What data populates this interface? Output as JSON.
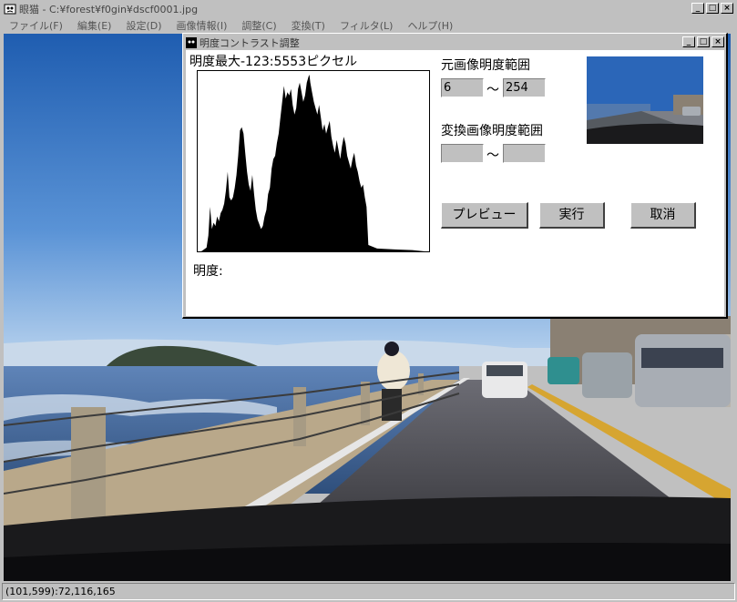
{
  "window": {
    "title": "眼猫 - C:¥forest¥f0gin¥dscf0001.jpg",
    "status": "(101,599):72,116,165"
  },
  "menu": [
    "ファイル(F)",
    "編集(E)",
    "設定(D)",
    "画像情報(I)",
    "調整(C)",
    "変換(T)",
    "フィルタ(L)",
    "ヘルプ(H)"
  ],
  "dialog": {
    "title": "明度コントラスト調整",
    "max_label": "明度最大-123:5553ピクセル",
    "brightness_label": "明度:",
    "source_range_label": "元画像明度範囲",
    "source_min": "6",
    "source_max": "254",
    "target_range_label": "変換画像明度範囲",
    "target_min": "",
    "target_max": "",
    "tilde": "～",
    "buttons": {
      "preview": "プレビュー",
      "execute": "実行",
      "cancel": "取消"
    }
  },
  "chart_data": {
    "type": "area",
    "title": "",
    "xlabel": "",
    "ylabel": "",
    "xlim": [
      0,
      255
    ],
    "ylim": [
      0,
      5553
    ],
    "peak": {
      "x": 123,
      "y": 5553
    },
    "x": [
      0,
      6,
      8,
      10,
      12,
      14,
      16,
      18,
      20,
      22,
      24,
      26,
      28,
      30,
      32,
      34,
      36,
      38,
      40,
      42,
      44,
      46,
      48,
      50,
      52,
      54,
      56,
      58,
      60,
      62,
      64,
      66,
      68,
      70,
      72,
      74,
      76,
      78,
      80,
      82,
      84,
      86,
      88,
      90,
      92,
      94,
      96,
      98,
      100,
      102,
      104,
      106,
      108,
      110,
      112,
      114,
      116,
      118,
      120,
      122,
      123,
      124,
      126,
      128,
      130,
      132,
      134,
      136,
      138,
      140,
      142,
      144,
      146,
      148,
      150,
      152,
      154,
      156,
      158,
      160,
      162,
      164,
      166,
      168,
      170,
      172,
      174,
      176,
      178,
      180,
      182,
      184,
      186,
      188,
      190,
      200,
      220,
      240,
      254
    ],
    "values": [
      0,
      120,
      500,
      1400,
      700,
      900,
      800,
      1100,
      950,
      1200,
      1300,
      1500,
      1900,
      2500,
      1700,
      1600,
      1700,
      2000,
      2400,
      3000,
      3800,
      3900,
      3700,
      3100,
      2500,
      2100,
      1900,
      2400,
      1800,
      1300,
      1000,
      850,
      700,
      800,
      1100,
      1300,
      1800,
      2000,
      2600,
      2900,
      3000,
      3400,
      3700,
      4200,
      4700,
      5200,
      4800,
      5000,
      4900,
      5100,
      4600,
      4300,
      4500,
      5100,
      5300,
      5000,
      4700,
      4900,
      5300,
      5500,
      5553,
      5300,
      5000,
      4700,
      4500,
      4300,
      4600,
      4200,
      3800,
      4000,
      3700,
      3900,
      4100,
      3600,
      3300,
      3100,
      3500,
      3200,
      2900,
      3300,
      3600,
      3400,
      3000,
      2800,
      2600,
      2900,
      3100,
      2700,
      2500,
      2200,
      2000,
      2100,
      1700,
      1400,
      200,
      90,
      60,
      40,
      0
    ]
  }
}
